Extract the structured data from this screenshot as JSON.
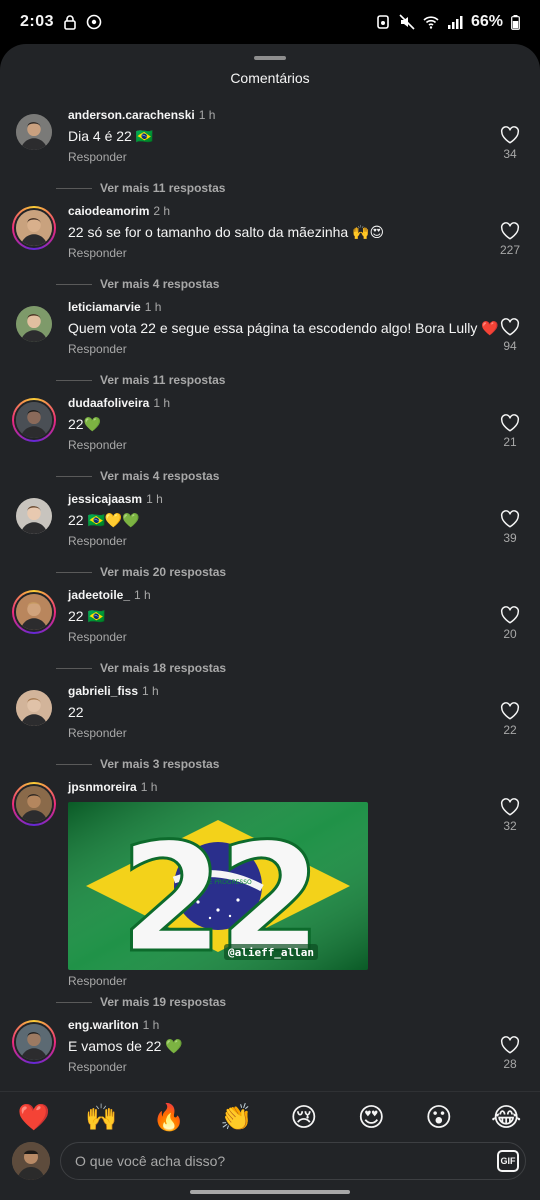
{
  "status_bar": {
    "time": "2:03",
    "battery": "66%"
  },
  "sheet": {
    "title": "Comentários"
  },
  "reply_label": "Responder",
  "comments": [
    {
      "user": "anderson.carachenski",
      "time": "1 h",
      "text": "Dia 4 é 22 🇧🇷",
      "likes": "34",
      "more": "Ver mais 11 respostas",
      "story_ring": false,
      "avatar_color": "#7a7a78"
    },
    {
      "user": "caiodeamorim",
      "time": "2 h",
      "text": "22 só se for o tamanho do salto da mãezinha 🙌😍",
      "likes": "227",
      "more": "Ver mais 4 respostas",
      "story_ring": true,
      "avatar_color": "#c9a27e"
    },
    {
      "user": "leticiamarvie",
      "time": "1 h",
      "text": "Quem vota 22 e segue essa página ta escodendo algo! Bora Lully ❤️",
      "likes": "94",
      "more": "Ver mais 11 respostas",
      "story_ring": false,
      "avatar_color": "#7e9a6a"
    },
    {
      "user": "dudaafoliveira",
      "time": "1 h",
      "text": "22💚",
      "likes": "21",
      "more": "Ver mais 4 respostas",
      "story_ring": true,
      "avatar_color": "#4a4f55"
    },
    {
      "user": "jessicajaasm",
      "time": "1 h",
      "text": "22 🇧🇷💛💚",
      "likes": "39",
      "more": "Ver mais 20 respostas",
      "story_ring": false,
      "avatar_color": "#c8c4be"
    },
    {
      "user": "jadeetoile_",
      "time": "1 h",
      "text": "22 🇧🇷",
      "likes": "20",
      "more": "Ver mais 18 respostas",
      "story_ring": true,
      "avatar_color": "#b9865d"
    },
    {
      "user": "gabrieli_fiss",
      "time": "1 h",
      "text": "22",
      "likes": "22",
      "more": "Ver mais 3 respostas",
      "story_ring": false,
      "avatar_color": "#d2b49a"
    },
    {
      "user": "jpsnmoreira",
      "time": "1 h",
      "text": "",
      "likes": "32",
      "more": "Ver mais 19 respostas",
      "story_ring": true,
      "avatar_color": "#8a6a4a",
      "sticker": {
        "number": "22",
        "flag_motto": "ORDEM E PROGRESSO",
        "watermark": "@alieff_allan"
      }
    },
    {
      "user": "eng.warliton",
      "time": "1 h",
      "text": "E vamos de 22 💚",
      "likes": "28",
      "more": "",
      "story_ring": true,
      "avatar_color": "#5c6a73"
    }
  ],
  "emoji_bar": [
    "❤️",
    "🙌",
    "🔥",
    "👏",
    "😢",
    "😍",
    "😮",
    "😂"
  ],
  "input": {
    "placeholder": "O que você acha disso?",
    "gif_label": "GIF"
  }
}
